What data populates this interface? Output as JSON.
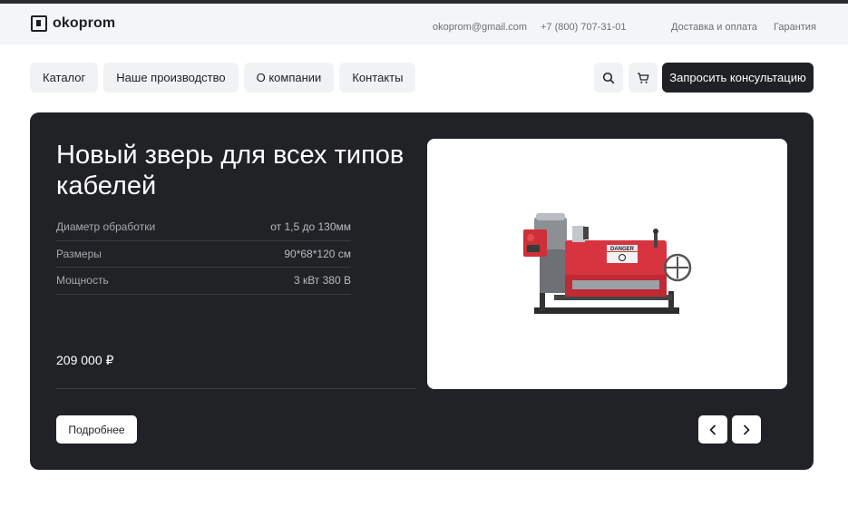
{
  "header": {
    "logo_text": "okoprom",
    "email": "okoprom@gmail.com",
    "phone": "+7 (800) 707-31-01",
    "links": [
      "Доставка и оплата",
      "Гарантия"
    ]
  },
  "nav": {
    "items": [
      "Каталог",
      "Наше производство",
      "О компании",
      "Контакты"
    ],
    "search_icon": "search-icon",
    "cart_icon": "cart-icon",
    "cta_label": "Запросить консультацию"
  },
  "hero": {
    "title": "Новый зверь для всех типов кабелей",
    "specs": [
      {
        "label": "Диаметр обработки",
        "value": "от 1,5 до 130мм"
      },
      {
        "label": "Размеры",
        "value": "90*68*120 см"
      },
      {
        "label": "Мощность",
        "value": "3 кВт 380 В"
      }
    ],
    "price": "209 000 ₽",
    "more_label": "Подробнее",
    "machine_label": "DANGER",
    "prev_icon": "chevron-left-icon",
    "next_icon": "chevron-right-icon"
  },
  "colors": {
    "dark": "#212226",
    "accent_red": "#d8343f",
    "light_bg": "#f4f5f7"
  }
}
